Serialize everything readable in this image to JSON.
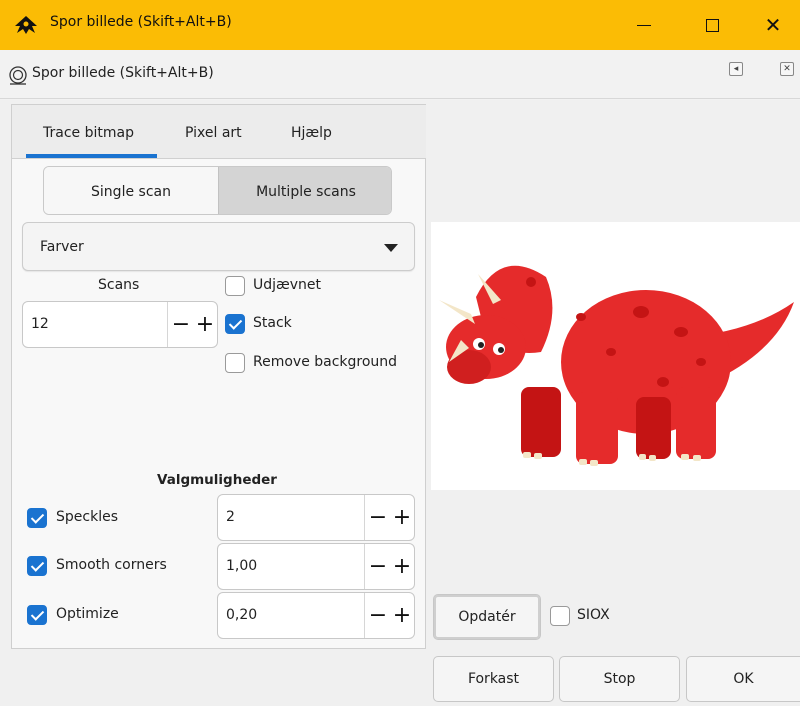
{
  "window": {
    "title": "Spor billede  (Skift+Alt+B)"
  },
  "dock": {
    "title": "Spor billede  (Skift+Alt+B)"
  },
  "tabs": [
    {
      "label": "Trace bitmap"
    },
    {
      "label": "Pixel art"
    },
    {
      "label": "Hjælp"
    }
  ],
  "scan_mode": {
    "single": "Single scan",
    "multiple": "Multiple scans"
  },
  "dropdown": {
    "selected": "Farver"
  },
  "scans": {
    "label": "Scans",
    "value": "12"
  },
  "checks": {
    "udjaevnet": {
      "label": "Udjævnet",
      "checked": false
    },
    "stack": {
      "label": "Stack",
      "checked": true
    },
    "remove_bg": {
      "label": "Remove background",
      "checked": false
    }
  },
  "options": {
    "heading": "Valgmuligheder",
    "speckles": {
      "label": "Speckles",
      "value": "2",
      "checked": true
    },
    "smooth": {
      "label": "Smooth corners",
      "value": "1,00",
      "checked": true
    },
    "optimize": {
      "label": "Optimize",
      "value": "0,20",
      "checked": true
    }
  },
  "preview_controls": {
    "update": "Opdatér",
    "siox": "SIOX",
    "siox_checked": false
  },
  "footer": {
    "discard": "Forkast",
    "stop": "Stop",
    "ok": "OK"
  },
  "colors": {
    "titlebar": "#fbbc05",
    "accent": "#1a73d0",
    "dino": "#e52b2b",
    "dino_dark": "#c41414",
    "horn": "#f3e6c8"
  },
  "icons": {
    "minimize": "minimize-icon",
    "maximize": "maximize-icon",
    "close": "close-icon",
    "minus": "−",
    "plus": "+"
  }
}
